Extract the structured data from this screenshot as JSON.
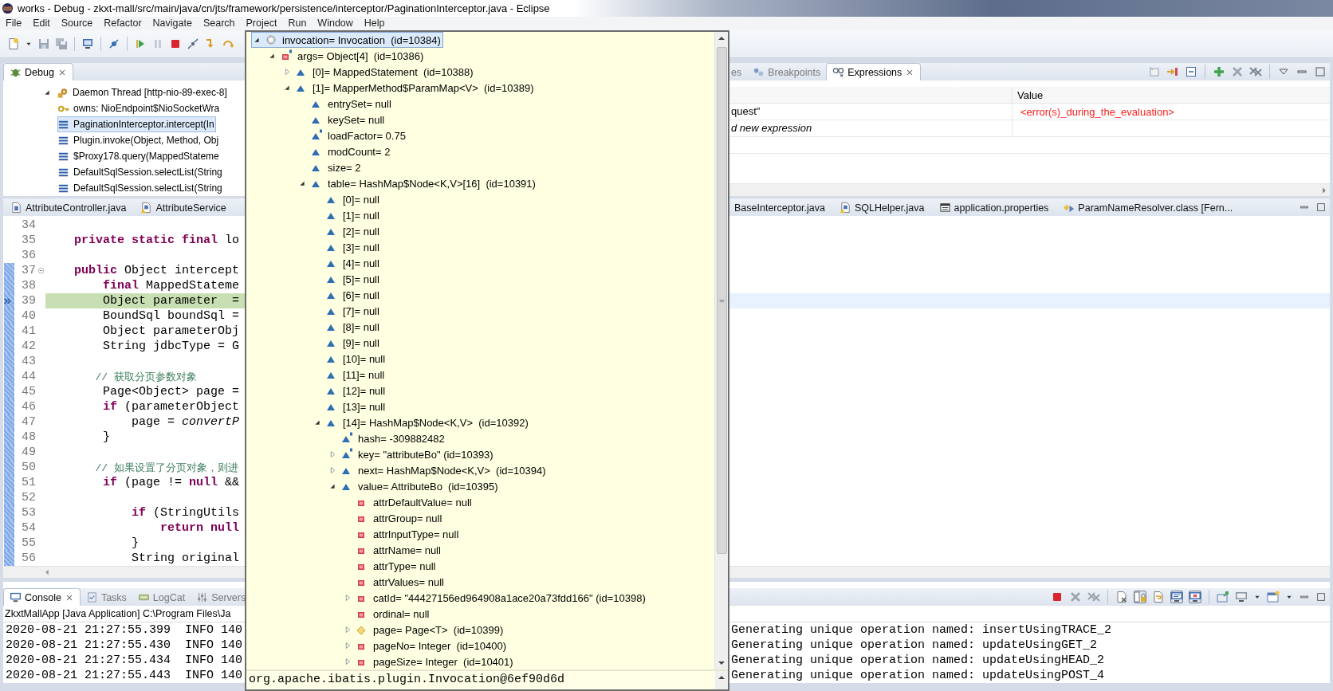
{
  "window": {
    "title": "works - Debug - zkxt-mall/src/main/java/cn/jts/framework/persistence/interceptor/PaginationInterceptor.java - Eclipse"
  },
  "menu": [
    "File",
    "Edit",
    "Source",
    "Refactor",
    "Navigate",
    "Search",
    "Project",
    "Run",
    "Window",
    "Help"
  ],
  "debug_view": {
    "tab": {
      "label": "Debug",
      "selected": true
    },
    "tree": [
      {
        "kind": "thread",
        "label": "Daemon Thread [http-nio-89-exec-8]",
        "expanded": true,
        "selected": false,
        "children": [
          {
            "kind": "monitor",
            "label": "owns: NioEndpoint$NioSocketWra",
            "selected": false
          },
          {
            "kind": "frame",
            "label": "PaginationInterceptor.intercept(In",
            "selected": true
          },
          {
            "kind": "frame",
            "label": "Plugin.invoke(Object, Method, Obj",
            "selected": false
          },
          {
            "kind": "frame",
            "label": "$Proxy178.query(MappedStateme",
            "selected": false
          },
          {
            "kind": "frame",
            "label": "DefaultSqlSession.selectList(String",
            "selected": false
          },
          {
            "kind": "frame",
            "label": "DefaultSqlSession.selectList(String",
            "selected": false
          }
        ]
      }
    ]
  },
  "expressions_view": {
    "tabs": [
      {
        "label": "es",
        "kind": "variables",
        "selected": false
      },
      {
        "label": "Breakpoints",
        "kind": "breakpoints",
        "selected": false
      },
      {
        "label": "Expressions",
        "kind": "expressions",
        "selected": true
      }
    ],
    "columns": [
      "Value"
    ],
    "rows": [
      {
        "kind": "expression",
        "expression": "quest\"",
        "value": "<error(s)_during_the_evaluation>",
        "error": true
      },
      {
        "kind": "add",
        "expression": "d new expression"
      }
    ]
  },
  "editor": {
    "tabs": [
      {
        "label": "AttributeController.java",
        "kind": "java",
        "selected": false
      },
      {
        "label": "AttributeService",
        "kind": "java-warning",
        "selected": false
      },
      {
        "label": "BaseInterceptor.java",
        "selected": false
      },
      {
        "label": "SQLHelper.java",
        "kind": "java-warning",
        "selected": false
      },
      {
        "label": "application.properties",
        "kind": "properties",
        "selected": false
      },
      {
        "label": "ParamNameResolver.class [Fern...",
        "kind": "class",
        "selected": false
      }
    ],
    "lines": [
      {
        "number": "34",
        "current": false,
        "range": false,
        "foldable": false
      },
      {
        "number": "35",
        "text": "    **private static final** lo",
        "current": false,
        "range": false,
        "foldable": false
      },
      {
        "number": "36",
        "current": false,
        "range": false,
        "foldable": false
      },
      {
        "number": "37",
        "text": "    **public** Object intercept",
        "current": false,
        "range": true,
        "foldable": true
      },
      {
        "number": "38",
        "text": "        **final** MappedStateme",
        "current": false,
        "range": true,
        "foldable": false
      },
      {
        "number": "39",
        "text": "        Object parameter  =",
        "current": true,
        "range": true,
        "foldable": false
      },
      {
        "number": "40",
        "text": "        BoundSql boundSql =",
        "current": false,
        "range": true,
        "foldable": false
      },
      {
        "number": "41",
        "text": "        Object parameterObj",
        "current": false,
        "range": true,
        "foldable": false
      },
      {
        "number": "42",
        "text": "        String jdbcType = G",
        "current": false,
        "range": true,
        "foldable": false
      },
      {
        "number": "43",
        "current": false,
        "range": true,
        "foldable": false
      },
      {
        "number": "44",
        "kind": "comment",
        "text": "        // 获取分页参数对象",
        "current": false,
        "range": true,
        "foldable": false
      },
      {
        "number": "45",
        "text": "        Page<Object> page =",
        "current": false,
        "range": true,
        "foldable": false
      },
      {
        "number": "46",
        "text": "        **if** (parameterObject",
        "current": false,
        "range": true,
        "foldable": false
      },
      {
        "number": "47",
        "text": "            page = *convertP*",
        "current": false,
        "range": true,
        "foldable": false
      },
      {
        "number": "48",
        "text": "        }",
        "current": false,
        "range": true,
        "foldable": false
      },
      {
        "number": "49",
        "current": false,
        "range": true,
        "foldable": false
      },
      {
        "number": "50",
        "kind": "comment",
        "text": "        // 如果设置了分页对象，则进",
        "current": false,
        "range": true,
        "foldable": false
      },
      {
        "number": "51",
        "text": "        **if** (page != **null** &&",
        "current": false,
        "range": true,
        "foldable": false
      },
      {
        "number": "52",
        "current": false,
        "range": true,
        "foldable": false
      },
      {
        "number": "53",
        "text": "            **if** (StringUtils",
        "current": false,
        "range": true,
        "foldable": false
      },
      {
        "number": "54",
        "text": "                **return null**",
        "current": false,
        "range": true,
        "foldable": false
      },
      {
        "number": "55",
        "text": "            }",
        "current": false,
        "range": true,
        "foldable": false
      },
      {
        "number": "56",
        "text": "            String original",
        "current": false,
        "range": true,
        "foldable": false
      }
    ]
  },
  "inspect_popup": {
    "tree": [
      {
        "label": "invocation= Invocation  (id=10384)",
        "kind": "local",
        "final": false,
        "expanded": true,
        "selected": true,
        "children": [
          {
            "label": "args= Object[4]  (id=10386)",
            "kind": "private",
            "final": true,
            "expanded": true,
            "selected": false,
            "children": [
              {
                "label": "[0]= MappedStatement  (id=10388)",
                "kind": "package",
                "final": false,
                "expanded": false,
                "selected": false
              },
              {
                "label": "[1]= MapperMethod$ParamMap<V>  (id=10389)",
                "kind": "package",
                "final": false,
                "expanded": true,
                "selected": false,
                "children": [
                  {
                    "label": "entrySet= null",
                    "kind": "package",
                    "final": false,
                    "selected": false
                  },
                  {
                    "label": "keySet= null",
                    "kind": "package",
                    "final": false,
                    "selected": false
                  },
                  {
                    "label": "loadFactor= 0.75",
                    "kind": "package",
                    "final": true,
                    "selected": false
                  },
                  {
                    "label": "modCount= 2",
                    "kind": "package",
                    "final": false,
                    "selected": false
                  },
                  {
                    "label": "size= 2",
                    "kind": "package",
                    "final": false,
                    "selected": false
                  },
                  {
                    "label": "table= HashMap$Node<K,V>[16]  (id=10391)",
                    "kind": "package",
                    "final": false,
                    "expanded": true,
                    "selected": false,
                    "children": [
                      {
                        "label": "[0]= null",
                        "kind": "package",
                        "final": false,
                        "selected": false
                      },
                      {
                        "label": "[1]= null",
                        "kind": "package",
                        "final": false,
                        "selected": false
                      },
                      {
                        "label": "[2]= null",
                        "kind": "package",
                        "final": false,
                        "selected": false
                      },
                      {
                        "label": "[3]= null",
                        "kind": "package",
                        "final": false,
                        "selected": false
                      },
                      {
                        "label": "[4]= null",
                        "kind": "package",
                        "final": false,
                        "selected": false
                      },
                      {
                        "label": "[5]= null",
                        "kind": "package",
                        "final": false,
                        "selected": false
                      },
                      {
                        "label": "[6]= null",
                        "kind": "package",
                        "final": false,
                        "selected": false
                      },
                      {
                        "label": "[7]= null",
                        "kind": "package",
                        "final": false,
                        "selected": false
                      },
                      {
                        "label": "[8]= null",
                        "kind": "package",
                        "final": false,
                        "selected": false
                      },
                      {
                        "label": "[9]= null",
                        "kind": "package",
                        "final": false,
                        "selected": false
                      },
                      {
                        "label": "[10]= null",
                        "kind": "package",
                        "final": false,
                        "selected": false
                      },
                      {
                        "label": "[11]= null",
                        "kind": "package",
                        "final": false,
                        "selected": false
                      },
                      {
                        "label": "[12]= null",
                        "kind": "package",
                        "final": false,
                        "selected": false
                      },
                      {
                        "label": "[13]= null",
                        "kind": "package",
                        "final": false,
                        "selected": false
                      },
                      {
                        "label": "[14]= HashMap$Node<K,V>  (id=10392)",
                        "kind": "package",
                        "final": false,
                        "expanded": true,
                        "selected": false,
                        "children": [
                          {
                            "label": "hash= -309882482",
                            "kind": "package",
                            "final": true,
                            "selected": false
                          },
                          {
                            "label": "key= \"attributeBo\" (id=10393)",
                            "kind": "package",
                            "final": true,
                            "expanded": false,
                            "selected": false
                          },
                          {
                            "label": "next= HashMap$Node<K,V>  (id=10394)",
                            "kind": "package",
                            "final": false,
                            "expanded": false,
                            "selected": false
                          },
                          {
                            "label": "value= AttributeBo  (id=10395)",
                            "kind": "package",
                            "final": false,
                            "expanded": true,
                            "selected": false,
                            "children": [
                              {
                                "label": "attrDefaultValue= null",
                                "kind": "private",
                                "final": false,
                                "selected": false
                              },
                              {
                                "label": "attrGroup= null",
                                "kind": "private",
                                "final": false,
                                "selected": false
                              },
                              {
                                "label": "attrInputType= null",
                                "kind": "private",
                                "final": false,
                                "selected": false
                              },
                              {
                                "label": "attrName= null",
                                "kind": "private",
                                "final": false,
                                "selected": false
                              },
                              {
                                "label": "attrType= null",
                                "kind": "private",
                                "final": false,
                                "selected": false
                              },
                              {
                                "label": "attrValues= null",
                                "kind": "private",
                                "final": false,
                                "selected": false
                              },
                              {
                                "label": "catId= \"44427156ed964908a1ace20a73fdd166\" (id=10398)",
                                "kind": "private",
                                "final": false,
                                "expanded": false,
                                "selected": false
                              },
                              {
                                "label": "ordinal= null",
                                "kind": "private",
                                "final": false,
                                "selected": false
                              },
                              {
                                "label": "page= Page<T>  (id=10399)",
                                "kind": "protected",
                                "final": false,
                                "expanded": false,
                                "selected": false
                              },
                              {
                                "label": "pageNo= Integer  (id=10400)",
                                "kind": "private",
                                "final": false,
                                "expanded": false,
                                "selected": false
                              },
                              {
                                "label": "pageSize= Integer  (id=10401)",
                                "kind": "private",
                                "final": false,
                                "expanded": false,
                                "selected": false
                              }
                            ]
                          }
                        ]
                      }
                    ]
                  }
                ]
              }
            ]
          }
        ]
      }
    ],
    "detail": "org.apache.ibatis.plugin.Invocation@6ef90d6d"
  },
  "console": {
    "tabs": [
      {
        "label": "Console",
        "kind": "console",
        "selected": true
      },
      {
        "label": "Tasks",
        "kind": "tasks",
        "selected": false
      },
      {
        "label": "LogCat",
        "kind": "logcat",
        "selected": false
      },
      {
        "label": "Servers",
        "kind": "servers",
        "selected": false
      }
    ],
    "toolbar": [
      {
        "kind": "terminate",
        "pressed": false
      },
      {
        "kind": "remove",
        "pressed": false
      },
      {
        "kind": "remove-all",
        "pressed": false
      },
      {
        "kind": "clear",
        "pressed": false
      },
      {
        "kind": "scroll-lock",
        "pressed": true
      },
      {
        "kind": "word-wrap",
        "pressed": false
      },
      {
        "kind": "stdout",
        "pressed": true
      },
      {
        "kind": "stderr",
        "pressed": true
      },
      {
        "kind": "pin",
        "pressed": false
      },
      {
        "kind": "display",
        "pressed": false
      },
      {
        "kind": "open",
        "pressed": false
      }
    ],
    "process": "ZkxtMallApp [Java Application] C:\\Program Files\\Ja",
    "lines": [
      {
        "left": "2020-08-21 21:27:55.399  INFO 140",
        "right": "Generating unique operation named: insertUsingTRACE_2"
      },
      {
        "left": "2020-08-21 21:27:55.430  INFO 140",
        "right": "Generating unique operation named: updateUsingGET_2"
      },
      {
        "left": "2020-08-21 21:27:55.434  INFO 140",
        "right": "Generating unique operation named: updateUsingHEAD_2"
      },
      {
        "left": "2020-08-21 21:27:55.443  INFO 140",
        "right": "Generating unique operation named: updateUsingPOST_4"
      }
    ]
  }
}
